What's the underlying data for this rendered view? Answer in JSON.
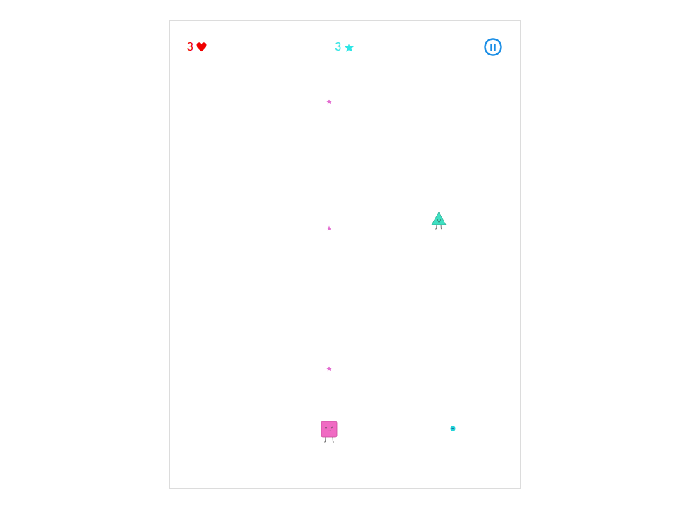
{
  "hud": {
    "lives": "3",
    "stars": "3",
    "paused": false
  },
  "entities": [
    {
      "kind": "star",
      "color": "#e36bd0"
    },
    {
      "kind": "star",
      "color": "#e36bd0"
    },
    {
      "kind": "star",
      "color": "#e36bd0"
    },
    {
      "kind": "enemy",
      "color": "#3fe0c2"
    },
    {
      "kind": "player",
      "color": "#f06bc3"
    },
    {
      "kind": "gem",
      "color": "#22d3d8"
    }
  ]
}
